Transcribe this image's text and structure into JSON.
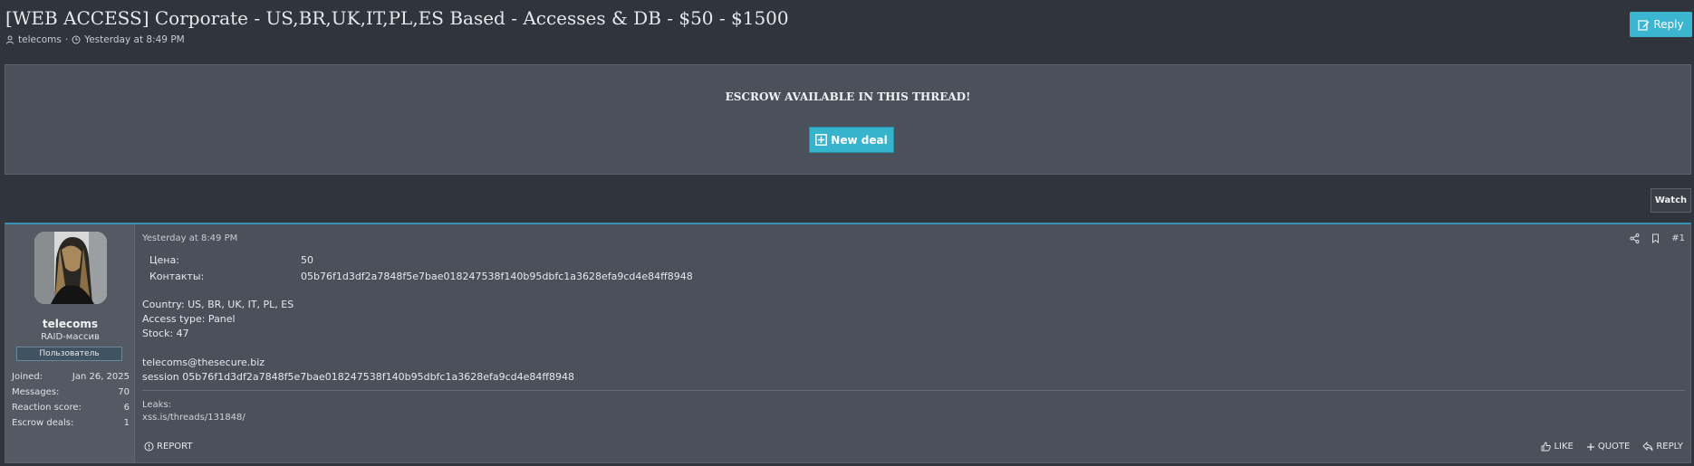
{
  "thread": {
    "title": "[WEB ACCESS] Corporate - US,BR,UK,IT,PL,ES Based - Accesses & DB - $50 - $1500",
    "author": "telecoms",
    "date": "Yesterday at 8:49 PM",
    "reply_label": "Reply"
  },
  "escrow": {
    "heading": "ESCROW AVAILABLE IN THIS THREAD!",
    "new_deal_label": "New deal"
  },
  "watch_label": "Watch",
  "post": {
    "user": {
      "name": "telecoms",
      "title": "RAID-массив",
      "badge": "Пользователь",
      "stats": [
        {
          "label": "Joined:",
          "value": "Jan 26, 2025"
        },
        {
          "label": "Messages:",
          "value": "70"
        },
        {
          "label": "Reaction score:",
          "value": "6"
        },
        {
          "label": "Escrow deals:",
          "value": "1"
        }
      ]
    },
    "date": "Yesterday at 8:49 PM",
    "number": "#1",
    "fields": [
      {
        "label": "Цена:",
        "value": "50"
      },
      {
        "label": "Контакты:",
        "value": "05b76f1d3df2a7848f5e7bae018247538f140b95dbfc1a3628efa9cd4e84ff8948"
      }
    ],
    "lines": [
      "Country: US, BR, UK, IT, PL, ES",
      "Access type: Panel",
      "Stock: 47",
      "telecoms@thesecure.biz",
      "session 05b76f1d3df2a7848f5e7bae018247538f140b95dbfc1a3628efa9cd4e84ff8948"
    ],
    "signature": {
      "label": "Leaks:",
      "link": "xss.is/threads/131848/"
    },
    "actions": {
      "report": "REPORT",
      "like": "LIKE",
      "quote": "QUOTE",
      "reply": "REPLY"
    }
  },
  "colors": {
    "accent": "#3bb5d0",
    "background": "#2f343d",
    "panel": "#4b515b",
    "post_border_top": "#3a93b5"
  }
}
